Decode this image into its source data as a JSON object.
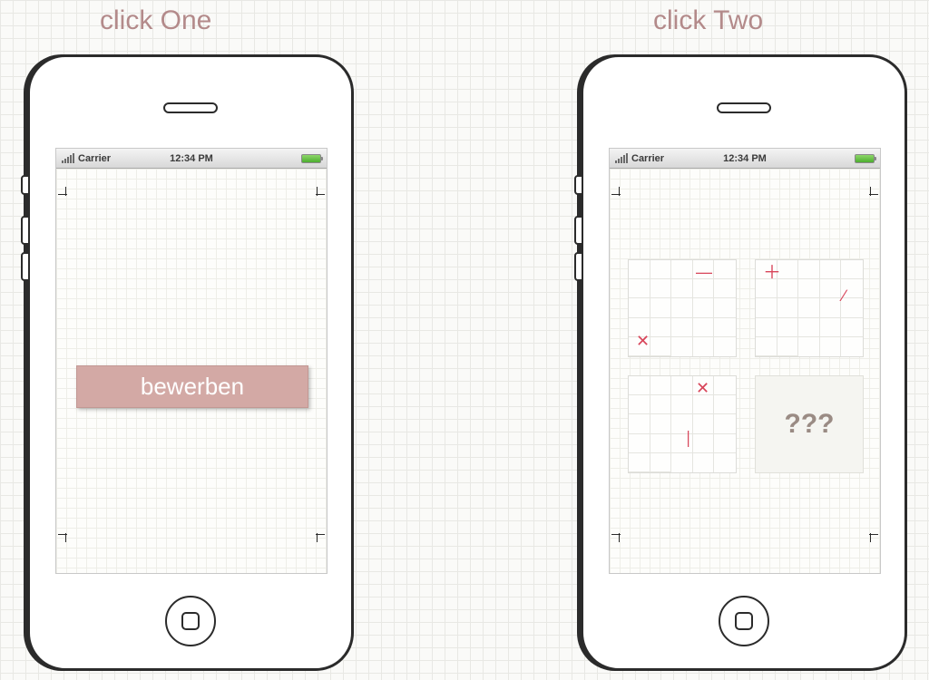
{
  "titles": {
    "left": "click One",
    "right": "click Two"
  },
  "statusbar": {
    "carrier": "Carrier",
    "time": "12:34 PM"
  },
  "button": {
    "bewerben": "bewerben"
  },
  "puzzle": {
    "question": "???"
  },
  "icons": {
    "signal": "signal-icon",
    "battery": "battery-icon",
    "home": "home-icon"
  }
}
